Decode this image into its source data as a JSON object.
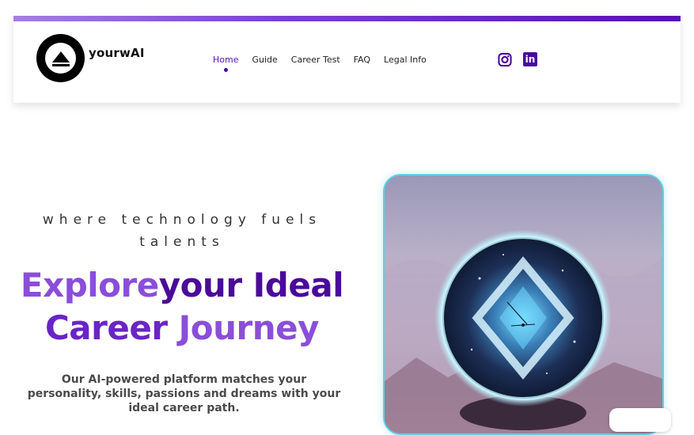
{
  "header": {
    "brand": "yourwAI",
    "nav": [
      {
        "label": "Home",
        "active": true
      },
      {
        "label": "Guide",
        "active": false
      },
      {
        "label": "Career Test",
        "active": false
      },
      {
        "label": "FAQ",
        "active": false
      },
      {
        "label": "Legal Info",
        "active": false
      }
    ],
    "social": [
      {
        "icon": "instagram-icon"
      },
      {
        "icon": "linkedin-icon",
        "text": "in"
      }
    ]
  },
  "hero": {
    "tagline": "where technology fuels talents",
    "headline_words": [
      "Explore",
      "your Ideal",
      "Career",
      "Journey"
    ],
    "description": "Our AI-powered platform matches your personality, skills, passions and dreams with your ideal career path.",
    "image": "crystal-ball-illustration"
  },
  "colors": {
    "accent_dark": "#4a0a9a",
    "accent_light": "#8a4ed9",
    "image_border": "#5fd1e6"
  }
}
